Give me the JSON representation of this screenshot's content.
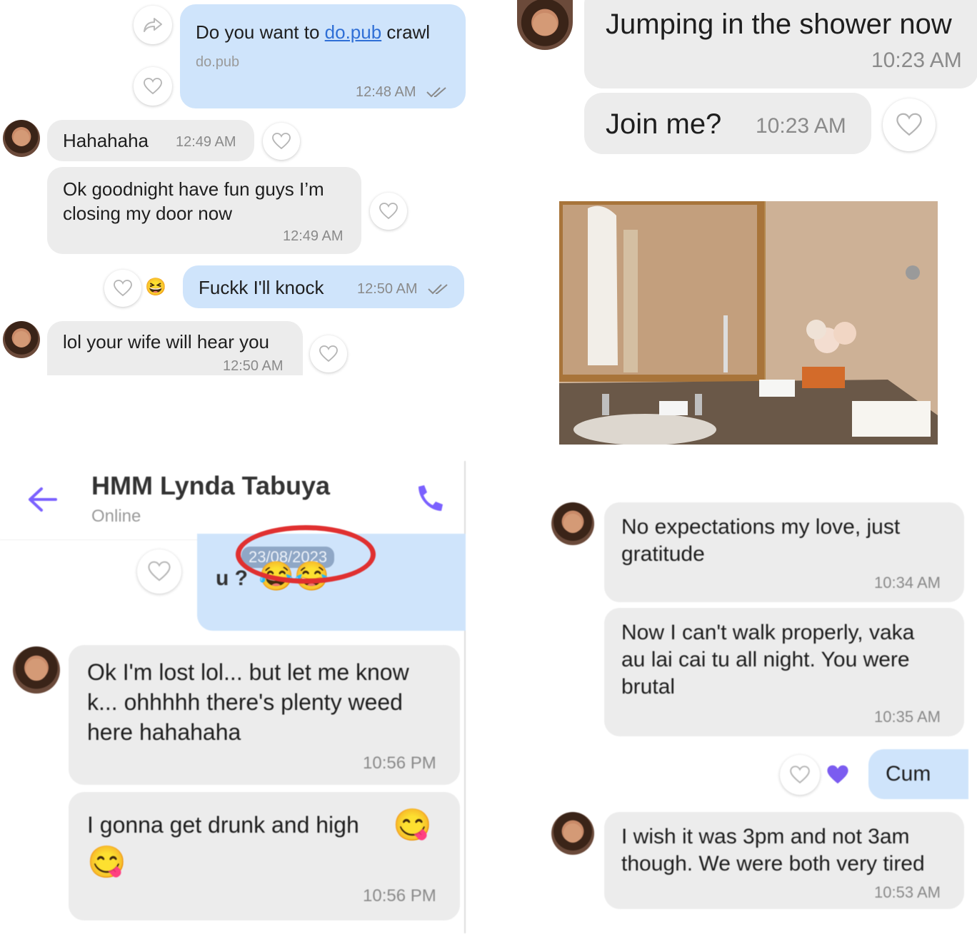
{
  "panel_top_left": {
    "messages": [
      {
        "text_before": "Do you want to ",
        "link": "do.pub",
        "text_after": " crawl",
        "preview": "do.pub",
        "time": "12:48 AM"
      },
      {
        "text": "Hahahaha",
        "time": "12:49 AM"
      },
      {
        "line1": "Ok goodnight have fun guys I’m",
        "line2": "closing my door now",
        "time": "12:49 AM"
      },
      {
        "text": "Fuckk I'll knock",
        "time": "12:50 AM",
        "reaction": "😆"
      },
      {
        "text": "lol your wife will hear you",
        "time": "12:50 AM"
      }
    ]
  },
  "panel_top_right": {
    "messages": [
      {
        "text": "Jumping in the shower now",
        "time": "10:23 AM"
      },
      {
        "text": "Join me?",
        "time": "10:23 AM"
      }
    ]
  },
  "panel_bottom_left": {
    "header": {
      "name": "HMM Lynda Tabuya",
      "status": "Online"
    },
    "outgoing_fragment": {
      "date_stamp": "23/08/2023",
      "text": "u ?",
      "emoji": "😂😂"
    },
    "messages": [
      {
        "line1": "Ok I'm lost lol... but let me know",
        "line2": "k... ohhhhh there's plenty weed",
        "line3": "here hahahaha",
        "time": "10:56 PM"
      },
      {
        "line1": "I gonna get drunk and high",
        "emoji": "😋",
        "time": "10:56 PM"
      }
    ]
  },
  "panel_bottom_right": {
    "messages": [
      {
        "line1": "No expectations my love, just",
        "line2": "gratitude",
        "time": "10:34 AM"
      },
      {
        "line1": "Now I can't walk properly, vaka",
        "line2": "au lai cai tu all night.  You were",
        "line3": "brutal",
        "time": "10:35 AM"
      },
      {
        "text": "Cum"
      },
      {
        "line1": "I wish it was 3pm and not 3am",
        "line2": "though. We were both very tired",
        "time": "10:53 AM"
      }
    ]
  },
  "colors": {
    "incoming": "#ececec",
    "outgoing": "#cfe4fb",
    "accent": "#7b61ff",
    "link": "#2f6fd6"
  }
}
